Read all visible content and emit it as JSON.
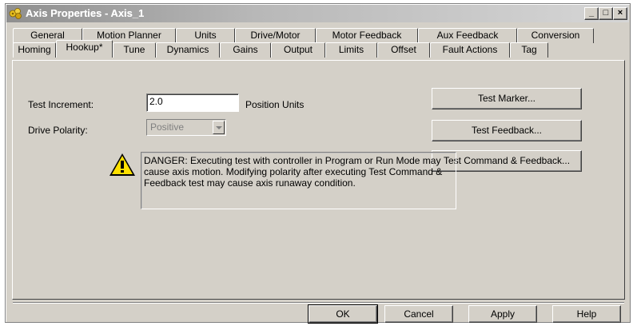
{
  "window": {
    "title": "Axis Properties - Axis_1",
    "minimize": "_",
    "maximize": "□",
    "close": "×"
  },
  "tabs_row1": [
    "General",
    "Motion Planner",
    "Units",
    "Drive/Motor",
    "Motor Feedback",
    "Aux Feedback",
    "Conversion"
  ],
  "tabs_row2": [
    "Homing",
    "Hookup*",
    "Tune",
    "Dynamics",
    "Gains",
    "Output",
    "Limits",
    "Offset",
    "Fault Actions",
    "Tag"
  ],
  "active_tab": "Hookup*",
  "form": {
    "test_increment_label": "Test Increment:",
    "test_increment_value": "2.0",
    "position_units_label": "Position Units",
    "drive_polarity_label": "Drive Polarity:",
    "drive_polarity_value": "Positive"
  },
  "actions": {
    "test_marker": "Test Marker...",
    "test_feedback": "Test Feedback...",
    "test_command_feedback": "Test Command & Feedback..."
  },
  "warning": {
    "icon": "warning-icon",
    "text": "DANGER: Executing test with controller in Program or Run Mode may cause axis motion. Modifying polarity after executing Test Command & Feedback test may cause axis runaway condition."
  },
  "footer": {
    "ok": "OK",
    "cancel": "Cancel",
    "apply": "Apply",
    "help": "Help"
  }
}
